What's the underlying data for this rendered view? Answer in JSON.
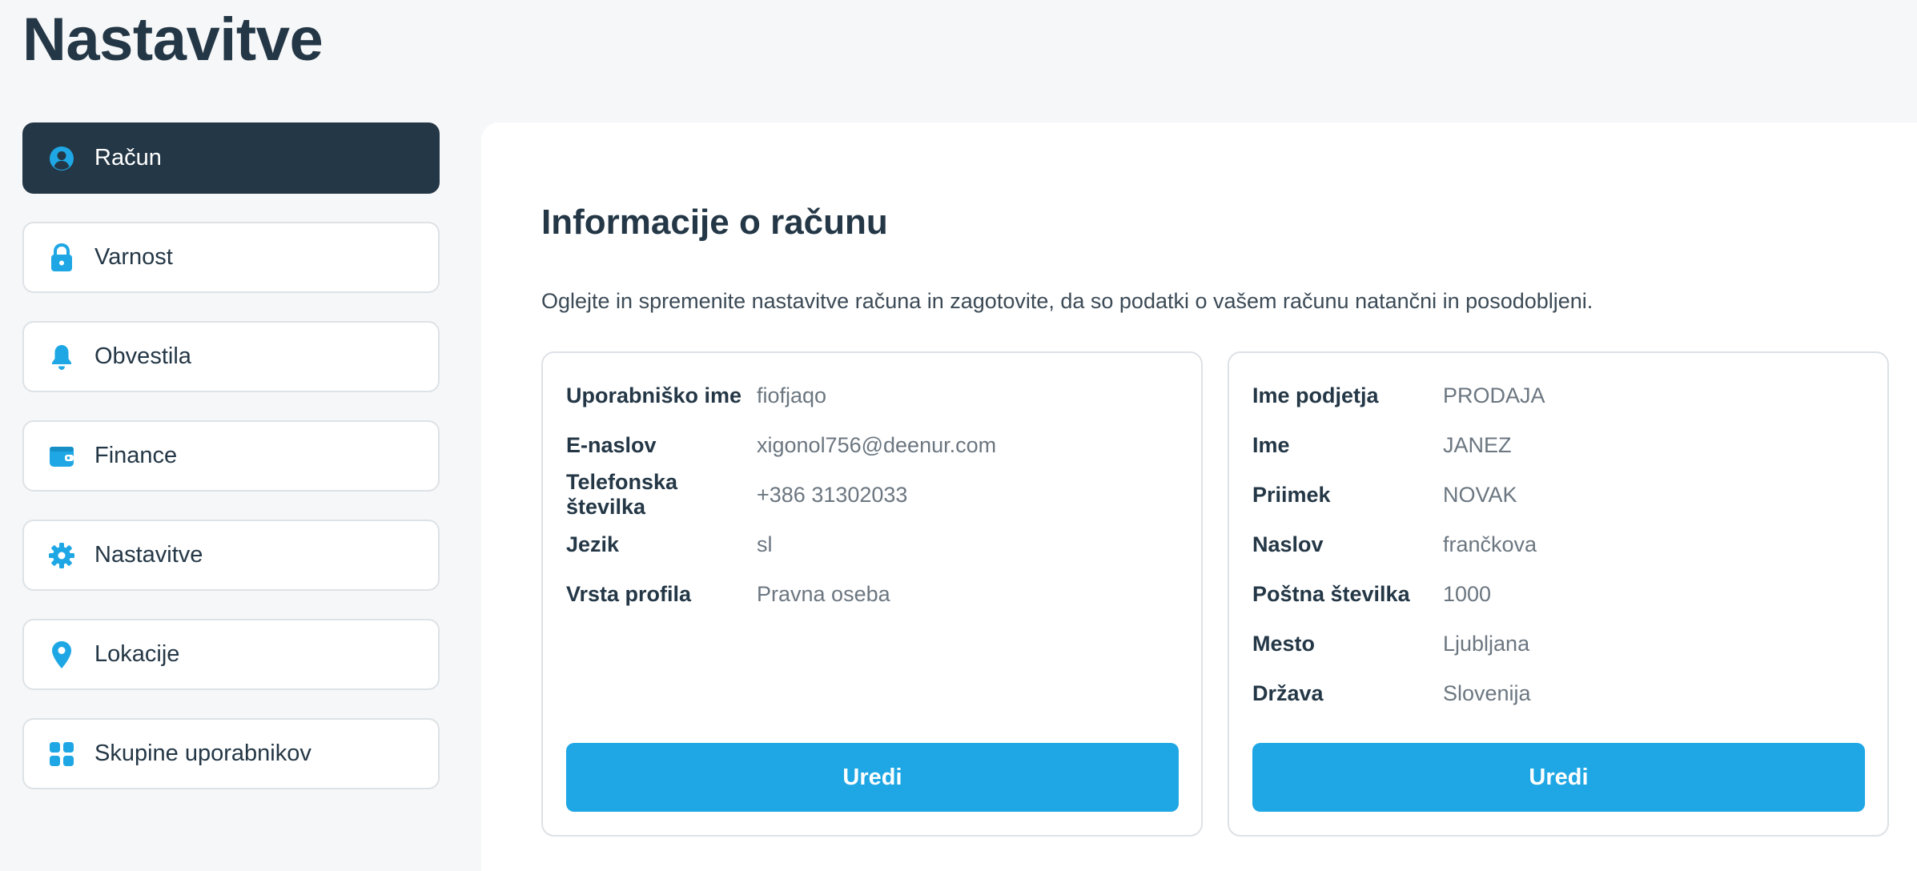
{
  "page": {
    "title": "Nastavitve"
  },
  "sidebar": {
    "items": [
      {
        "label": "Račun",
        "icon": "user-circle-icon",
        "active": true
      },
      {
        "label": "Varnost",
        "icon": "lock-icon",
        "active": false
      },
      {
        "label": "Obvestila",
        "icon": "bell-icon",
        "active": false
      },
      {
        "label": "Finance",
        "icon": "wallet-icon",
        "active": false
      },
      {
        "label": "Nastavitve",
        "icon": "gear-icon",
        "active": false
      },
      {
        "label": "Lokacije",
        "icon": "map-pin-icon",
        "active": false
      },
      {
        "label": "Skupine uporabnikov",
        "icon": "grid-icon",
        "active": false
      }
    ]
  },
  "main": {
    "title": "Informacije o računu",
    "description": "Oglejte in spremenite nastavitve računa in zagotovite, da so podatki o vašem računu natančni in posodobljeni.",
    "account_card": {
      "rows": [
        {
          "label": "Uporabniško ime",
          "value": "fiofjaqo"
        },
        {
          "label": "E-naslov",
          "value": "xigonol756@deenur.com"
        },
        {
          "label": "Telefonska številka",
          "value": "+386 31302033"
        },
        {
          "label": "Jezik",
          "value": "sl"
        },
        {
          "label": "Vrsta profila",
          "value": "Pravna oseba"
        }
      ],
      "button": "Uredi"
    },
    "company_card": {
      "rows": [
        {
          "label": "Ime podjetja",
          "value": "PRODAJA"
        },
        {
          "label": "Ime",
          "value": "JANEZ"
        },
        {
          "label": "Priimek",
          "value": "NOVAK"
        },
        {
          "label": "Naslov",
          "value": "frančkova"
        },
        {
          "label": "Poštna številka",
          "value": "1000"
        },
        {
          "label": "Mesto",
          "value": "Ljubljana"
        },
        {
          "label": "Država",
          "value": "Slovenija"
        }
      ],
      "button": "Uredi"
    }
  },
  "colors": {
    "accent": "#1ea7e4",
    "dark": "#243746",
    "border": "#dde2e6",
    "background": "#f6f7f8"
  }
}
